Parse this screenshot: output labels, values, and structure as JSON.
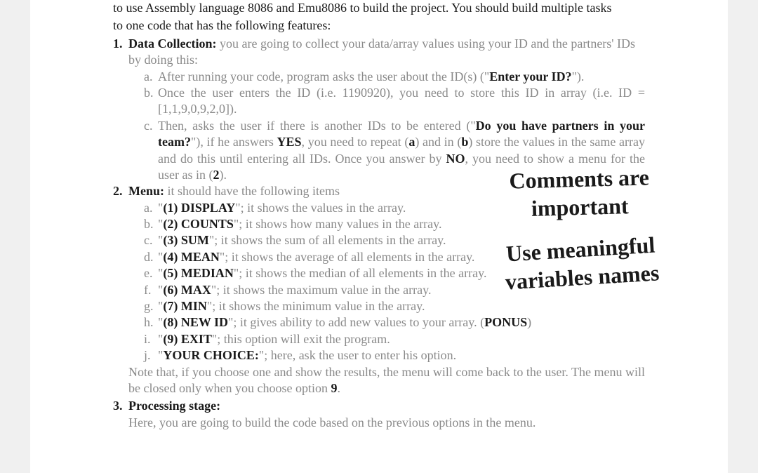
{
  "intro_line1": "to use Assembly language 8086 and Emu8086 to build the project. You should build multiple tasks",
  "intro_line2": "to one code that has the following features:",
  "sections": {
    "one": {
      "num": "1.",
      "title": "Data Collection:",
      "rest": " you are going to collect your data/array values using your ID and the partners' IDs by doing this:",
      "a": {
        "letter": "a.",
        "t1": "After running your code, program asks the user about the ID(s) (\"",
        "bold": "Enter your ID?",
        "t2": "\")."
      },
      "b": {
        "letter": "b.",
        "text": "Once the user enters the ID (i.e. 1190920), you need to store this ID in array (i.e. ID = [1,1,9,0,9,2,0])."
      },
      "c": {
        "letter": "c.",
        "t1": "Then, asks the user if there is another IDs to be entered (\"",
        "bold1": "Do you have partners in your team?",
        "t2": "\"), if he answers ",
        "bold2": "YES",
        "t3": ", you need to repeat (",
        "bold3": "a",
        "t4": ") and in (",
        "bold4": "b",
        "t5": ") store the values in the same array and do this until entering all IDs. Once you answer by ",
        "bold5": "NO",
        "t6": ", you need to show a menu for the user as in (",
        "bold6": "2",
        "t7": ")."
      }
    },
    "two": {
      "num": "2.",
      "title": "Menu:",
      "rest": " it should have the following items",
      "items": [
        {
          "letter": "a.",
          "q1": "\"",
          "code": "(1) DISPLAY",
          "desc": "\"; it shows the values in the array."
        },
        {
          "letter": "b.",
          "q1": "\"",
          "code": "(2) COUNTS",
          "desc": "\"; it shows how many values in the array."
        },
        {
          "letter": "c.",
          "q1": "\"",
          "code": "(3) SUM",
          "desc": "\"; it shows the sum of all elements in the array."
        },
        {
          "letter": "d.",
          "q1": "\"",
          "code": "(4) MEAN",
          "desc": "\"; it shows the average of all elements in the array."
        },
        {
          "letter": "e.",
          "q1": "\"",
          "code": "(5) MEDIAN",
          "desc": "\"; it shows the median of all elements in the array."
        },
        {
          "letter": "f.",
          "q1": "\"",
          "code": "(6) MAX",
          "desc": "\"; it shows the maximum value in the array."
        },
        {
          "letter": "g.",
          "q1": "\"",
          "code": "(7) MIN",
          "desc": "\"; it shows the minimum value in the array."
        }
      ],
      "h": {
        "letter": "h.",
        "q1": "\"",
        "code": "(8) NEW ID",
        "mid": "\"; it gives ability to add new values to your array. (",
        "bonus": "PONUS",
        "end": ")"
      },
      "i": {
        "letter": "i.",
        "q1": "\"",
        "code": "(9) EXIT",
        "desc": "\"; this option will exit the program."
      },
      "j_item": {
        "letter": "j.",
        "q1": "\"",
        "code": "YOUR CHOICE:",
        "desc": "\"; here, ask the user to enter his option."
      },
      "note_t1": "Note that, if you choose one and show the results, the menu will come back to the user. The menu will be closed only when you choose option ",
      "note_bold": "9",
      "note_t2": "."
    },
    "three": {
      "num": "3.",
      "title": "Processing stage:",
      "body": "Here, you are going to build the code based on the previous options in the menu."
    }
  },
  "annotations": {
    "a1_l1": "Comments are",
    "a1_l2": "important",
    "a2_l1": "Use meaningful",
    "a2_l2": "variables names"
  }
}
